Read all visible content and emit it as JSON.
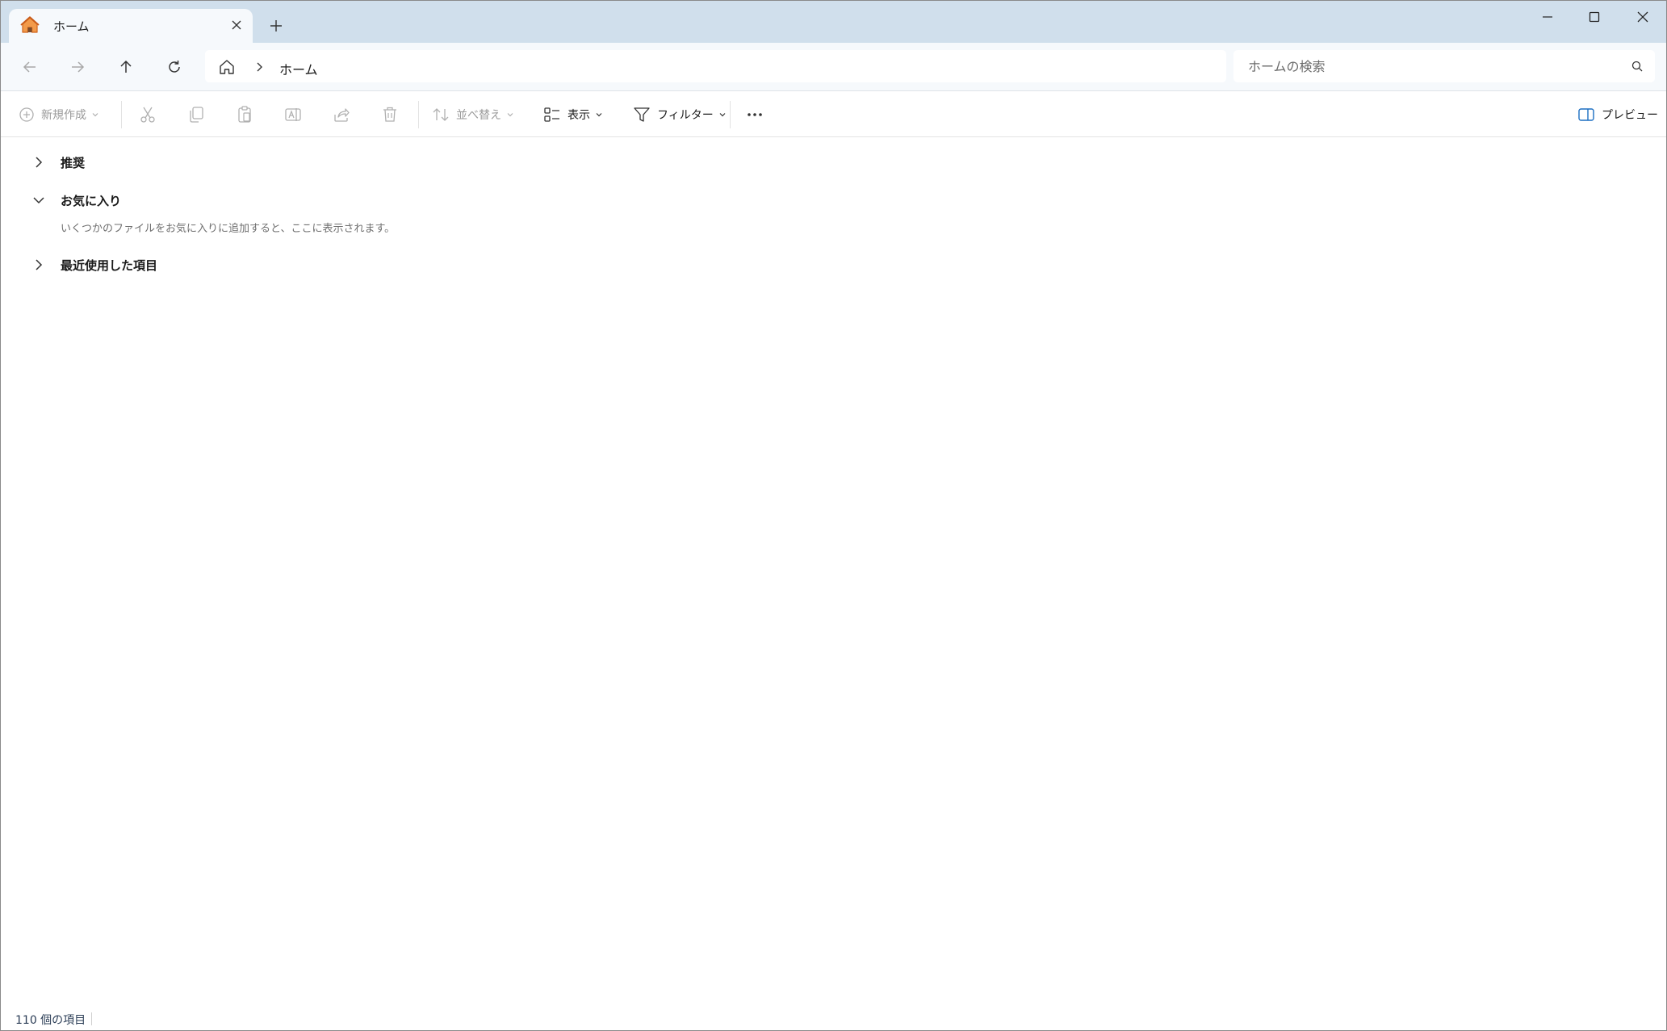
{
  "tab": {
    "title": "ホーム",
    "icon": "home-icon"
  },
  "window_controls": {
    "minimize": "minimize-icon",
    "maximize": "maximize-icon",
    "close": "close-icon"
  },
  "nav": {
    "back": "arrow-left-icon",
    "forward": "arrow-right-icon",
    "up": "arrow-up-icon",
    "refresh": "refresh-icon"
  },
  "address": {
    "crumb": "ホーム"
  },
  "search": {
    "placeholder": "ホームの検索"
  },
  "commands": {
    "new_label": "新規作成",
    "sort_label": "並べ替え",
    "view_label": "表示",
    "filter_label": "フィルター",
    "preview_label": "プレビュー"
  },
  "sections": [
    {
      "title": "推奨",
      "expanded": false
    },
    {
      "title": "お気に入り",
      "expanded": true,
      "empty_message": "いくつかのファイルをお気に入りに追加すると、ここに表示されます。"
    },
    {
      "title": "最近使用した項目",
      "expanded": false
    }
  ],
  "status": {
    "item_count": "110 個の項目"
  },
  "colors": {
    "tab_strip": "#d0dfec",
    "nav_background": "#f6f9fc",
    "home_icon_orange": "#e8762b",
    "accent_blue": "#1b6ec2"
  }
}
